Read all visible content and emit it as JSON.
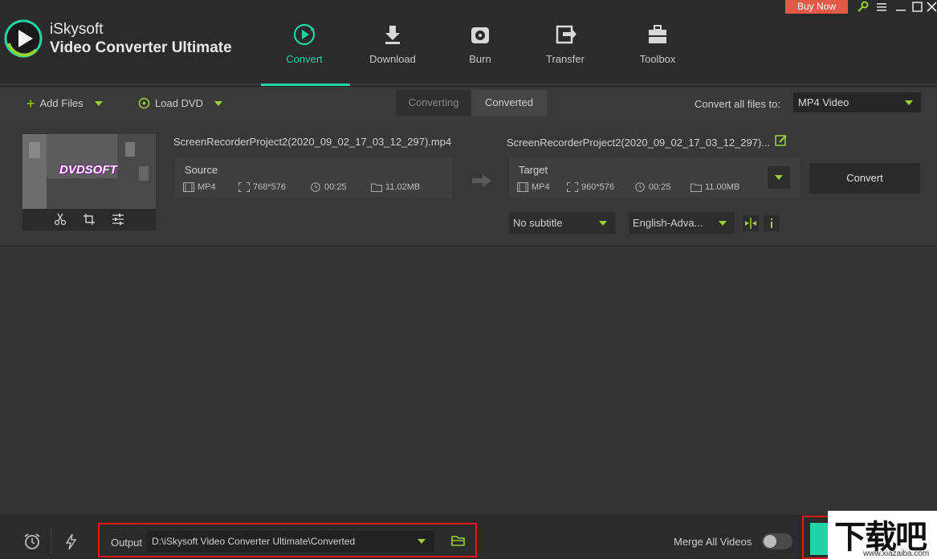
{
  "app": {
    "name_line1": "iSkysoft",
    "name_line2": "Video Converter Ultimate"
  },
  "window": {
    "buy_now": "Buy Now"
  },
  "nav": [
    {
      "label": "Convert",
      "icon": "convert-icon",
      "active": true
    },
    {
      "label": "Download",
      "icon": "download-icon"
    },
    {
      "label": "Burn",
      "icon": "burn-icon"
    },
    {
      "label": "Transfer",
      "icon": "transfer-icon"
    },
    {
      "label": "Toolbox",
      "icon": "toolbox-icon"
    }
  ],
  "toolbar": {
    "add_files": "Add Files",
    "load_dvd": "Load DVD",
    "tab_converting": "Converting",
    "tab_converted": "Converted",
    "convert_all_label": "Convert all files to:",
    "convert_all_value": "MP4 Video"
  },
  "file": {
    "source_name": "ScreenRecorderProject2(2020_09_02_17_03_12_297).mp4",
    "target_name": "ScreenRecorderProject2(2020_09_02_17_03_12_297)...",
    "thumb_text": "DVDSOFT",
    "source": {
      "title": "Source",
      "format": "MP4",
      "resolution": "768*576",
      "duration": "00:25",
      "size": "11.02MB"
    },
    "target": {
      "title": "Target",
      "format": "MP4",
      "resolution": "960*576",
      "duration": "00:25",
      "size": "11.00MB"
    },
    "convert_button": "Convert",
    "subtitle": "No subtitle",
    "audio": "English-Adva..."
  },
  "footer": {
    "output_label": "Output",
    "output_path": "D:\\iSkysoft Video Converter Ultimate\\Converted",
    "merge_label": "Merge All Videos",
    "merge_on": false
  },
  "watermark": {
    "text": "下载吧",
    "url": "www.xiazaiba.com"
  },
  "colors": {
    "accent": "#22d3a6",
    "lime": "#9bd232",
    "highlight": "#e01818",
    "buy": "#e25a47"
  }
}
